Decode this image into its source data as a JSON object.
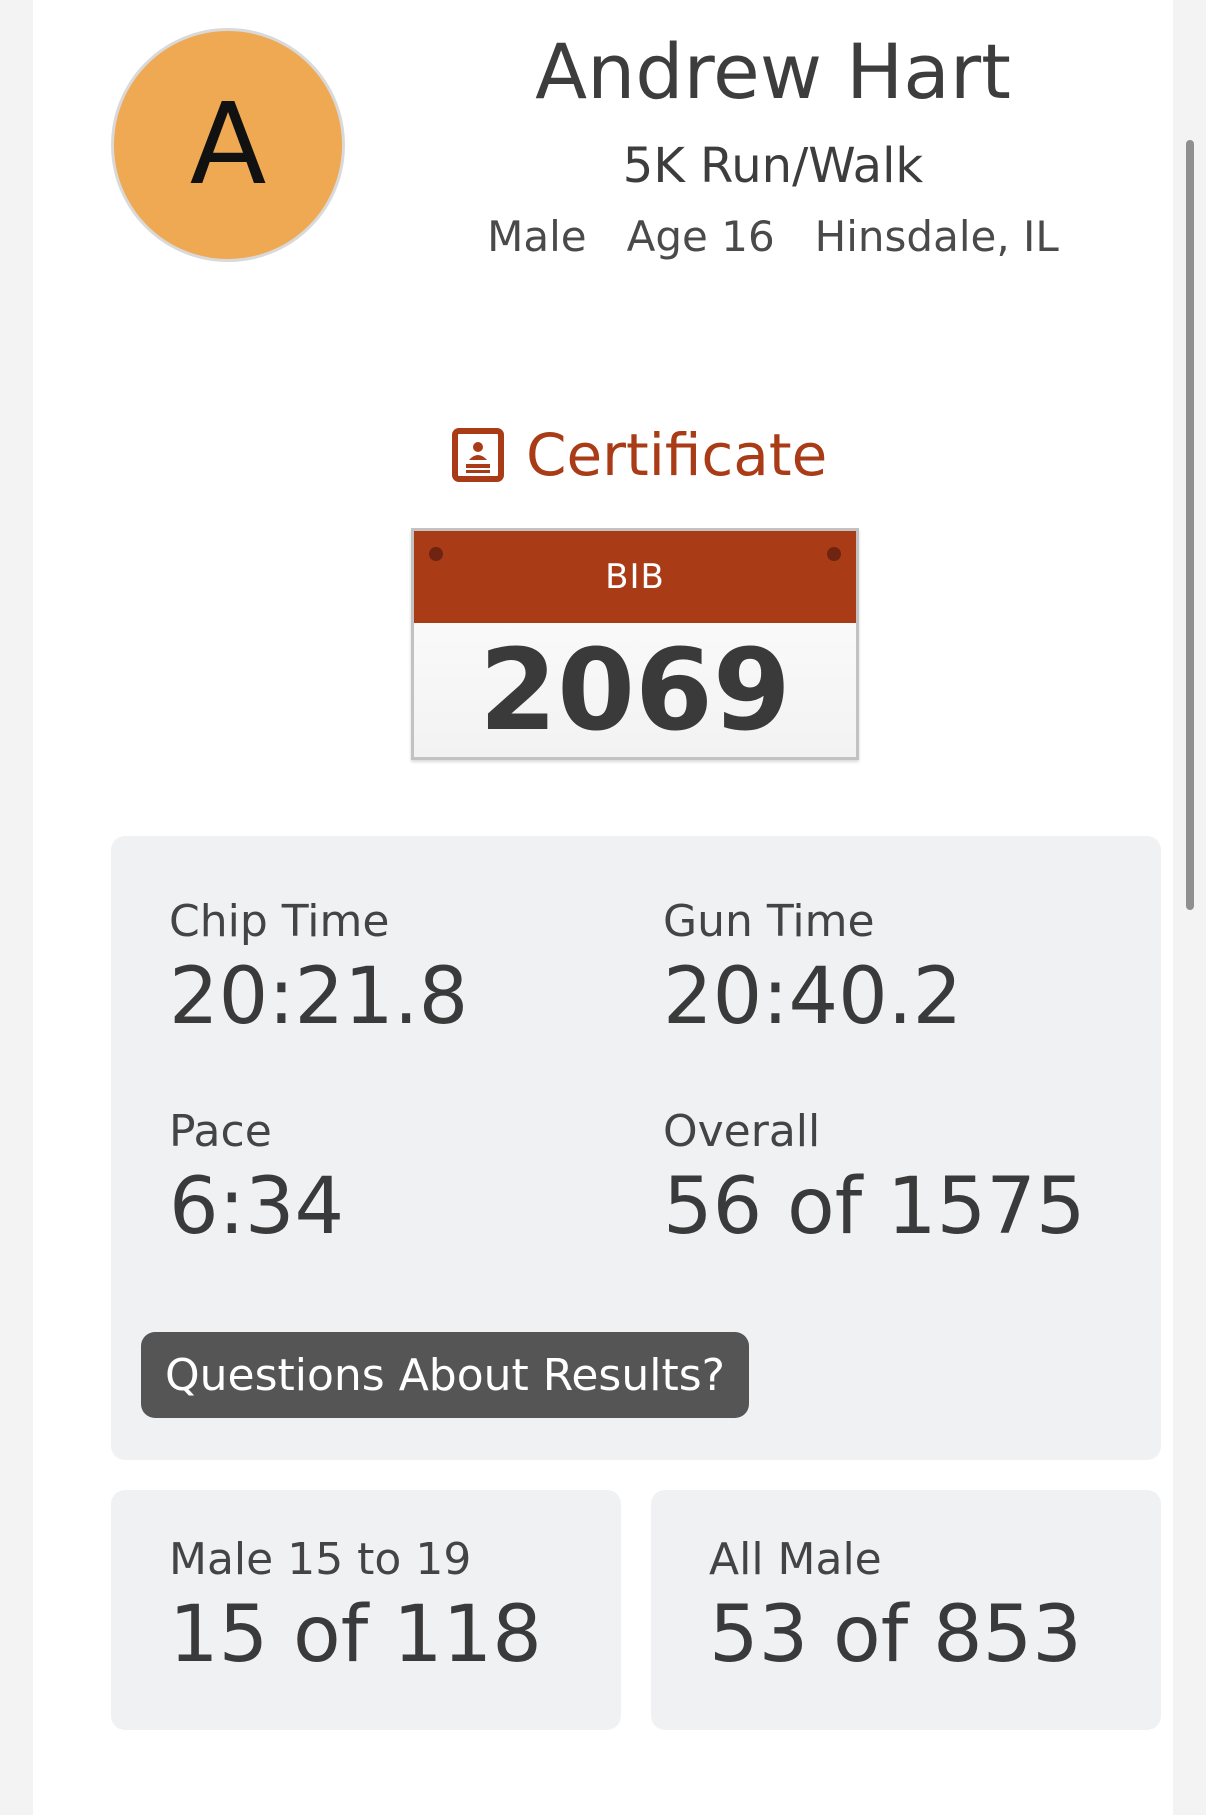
{
  "athlete": {
    "avatar_initial": "A",
    "name": "Andrew Hart",
    "race": "5K Run/Walk",
    "gender": "Male",
    "age": "Age 16",
    "location": "Hinsdale, IL"
  },
  "certificate": {
    "label": "Certificate",
    "icon": "certificate-icon"
  },
  "bib": {
    "label": "BIB",
    "number": "2069"
  },
  "results": {
    "chip_time_label": "Chip Time",
    "chip_time": "20:21.8",
    "gun_time_label": "Gun Time",
    "gun_time": "20:40.2",
    "pace_label": "Pace",
    "pace": "6:34",
    "overall_label": "Overall",
    "overall": "56 of 1575",
    "questions_button": "Questions About Results?"
  },
  "divisions": [
    {
      "label": "Male 15 to 19",
      "value": "15 of 118"
    },
    {
      "label": "All Male",
      "value": "53 of 853"
    }
  ],
  "colors": {
    "accent": "#a93b17",
    "avatar": "#efa952",
    "panel": "#f0f1f3",
    "button": "#555555"
  }
}
